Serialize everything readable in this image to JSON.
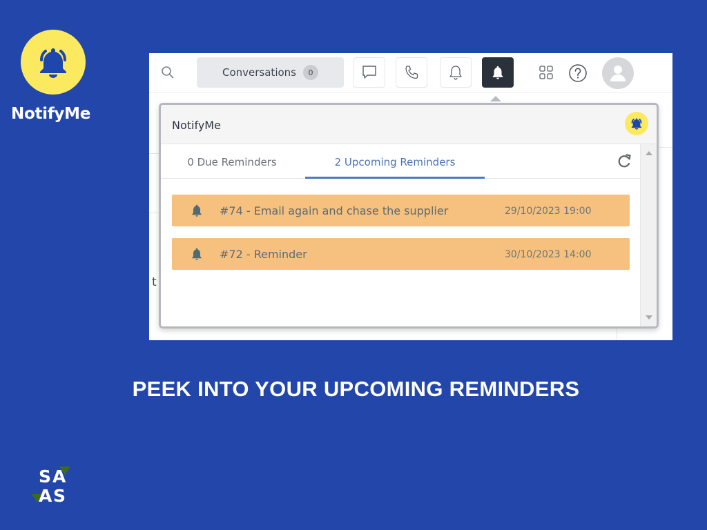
{
  "brand": {
    "name": "NotifyMe",
    "logo_icon": "ringing-bell-icon",
    "logo_bg": "#fbe960",
    "logo_fg": "#1e47ad"
  },
  "topbar": {
    "search_icon": "search-icon",
    "conversations_label": "Conversations",
    "conversations_count": "0",
    "buttons": [
      {
        "name": "chat",
        "icon": "chat-bubble-icon",
        "active": false
      },
      {
        "name": "phone",
        "icon": "phone-icon",
        "active": false
      },
      {
        "name": "notifications",
        "icon": "bell-outline-icon",
        "active": false
      },
      {
        "name": "notifyme",
        "icon": "bell-filled-icon",
        "active": true
      }
    ],
    "apps_icon": "apps-grid-icon",
    "help_icon": "help-circle-icon",
    "avatar_icon": "user-avatar-icon"
  },
  "background_page": {
    "stray_text": "t"
  },
  "popup": {
    "title": "NotifyMe",
    "badge_icon": "ringing-bell-icon",
    "tabs": [
      {
        "label": "0 Due Reminders",
        "active": false
      },
      {
        "label": "2 Upcoming Reminders",
        "active": true
      }
    ],
    "refresh_icon": "refresh-icon",
    "reminders": [
      {
        "icon": "bell-icon",
        "title": "#74 - Email again and chase the supplier",
        "datetime": "29/10/2023 19:00"
      },
      {
        "icon": "bell-icon",
        "title": "#72 - Reminder",
        "datetime": "30/10/2023 14:00"
      }
    ],
    "reminder_color": "#f6c07e"
  },
  "headline": "PEEK INTO YOUR UPCOMING REMINDERS",
  "footer_logo": {
    "letters": [
      "S",
      "A",
      "A",
      "S"
    ],
    "accent": "#3d6b1e"
  },
  "colors": {
    "background": "#2346ab",
    "active_tab": "#4a74b8"
  }
}
